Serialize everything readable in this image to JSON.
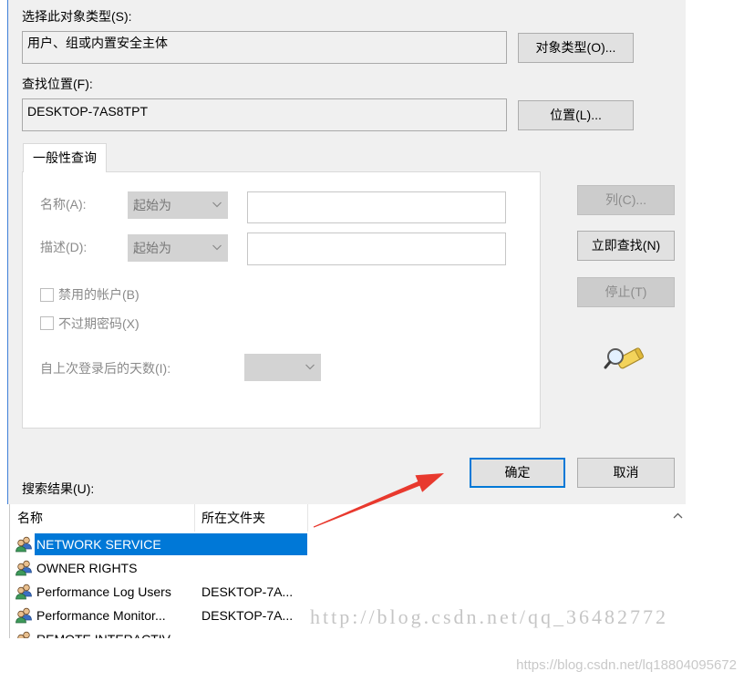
{
  "dialog": {
    "object_type_label": "选择此对象类型(S):",
    "object_type_value": "用户、组或内置安全主体",
    "object_type_button": "对象类型(O)...",
    "location_label": "查找位置(F):",
    "location_value": "DESKTOP-7AS8TPT",
    "location_button": "位置(L)..."
  },
  "query": {
    "tab": "一般性查询",
    "name_label": "名称(A):",
    "name_mode": "起始为",
    "description_label": "描述(D):",
    "description_mode": "起始为",
    "disabled_accounts": {
      "label": "禁用的帐户(B)",
      "checked": false
    },
    "non_expiring_password": {
      "label": "不过期密码(X)",
      "checked": false
    },
    "days_since_logon_label": "自上次登录后的天数(I):"
  },
  "actions": {
    "columns": {
      "label": "列(C)...",
      "enabled": false
    },
    "find_now": {
      "label": "立即查找(N)",
      "enabled": true
    },
    "stop": {
      "label": "停止(T)",
      "enabled": false
    },
    "ok": {
      "label": "确定",
      "default": true
    },
    "cancel": {
      "label": "取消"
    }
  },
  "results": {
    "label": "搜索结果(U):",
    "columns": [
      "名称",
      "所在文件夹"
    ],
    "rows": [
      {
        "name": "NETWORK SERVICE",
        "selected": true
      },
      {
        "name": "OWNER RIGHTS"
      },
      {
        "name": "Performance Log Users",
        "folder": "DESKTOP-7A..."
      },
      {
        "name": "Performance Monitor...",
        "folder": "DESKTOP-7A..."
      },
      {
        "name": "REMOTE INTERACTIV"
      }
    ]
  },
  "watermarks": {
    "overlay": "http://blog.csdn.net/qq_36482772",
    "footer": "https://blog.csdn.net/lq18804095672"
  },
  "icons": {
    "row": "user-group-icon",
    "find": "search-icon",
    "dropdown": "chevron-down-icon",
    "scroll": "chevron-up-icon"
  },
  "colors": {
    "selection": "#0078d7",
    "annotation": "#e8392e",
    "dialog_bg": "#f0f0f0"
  }
}
